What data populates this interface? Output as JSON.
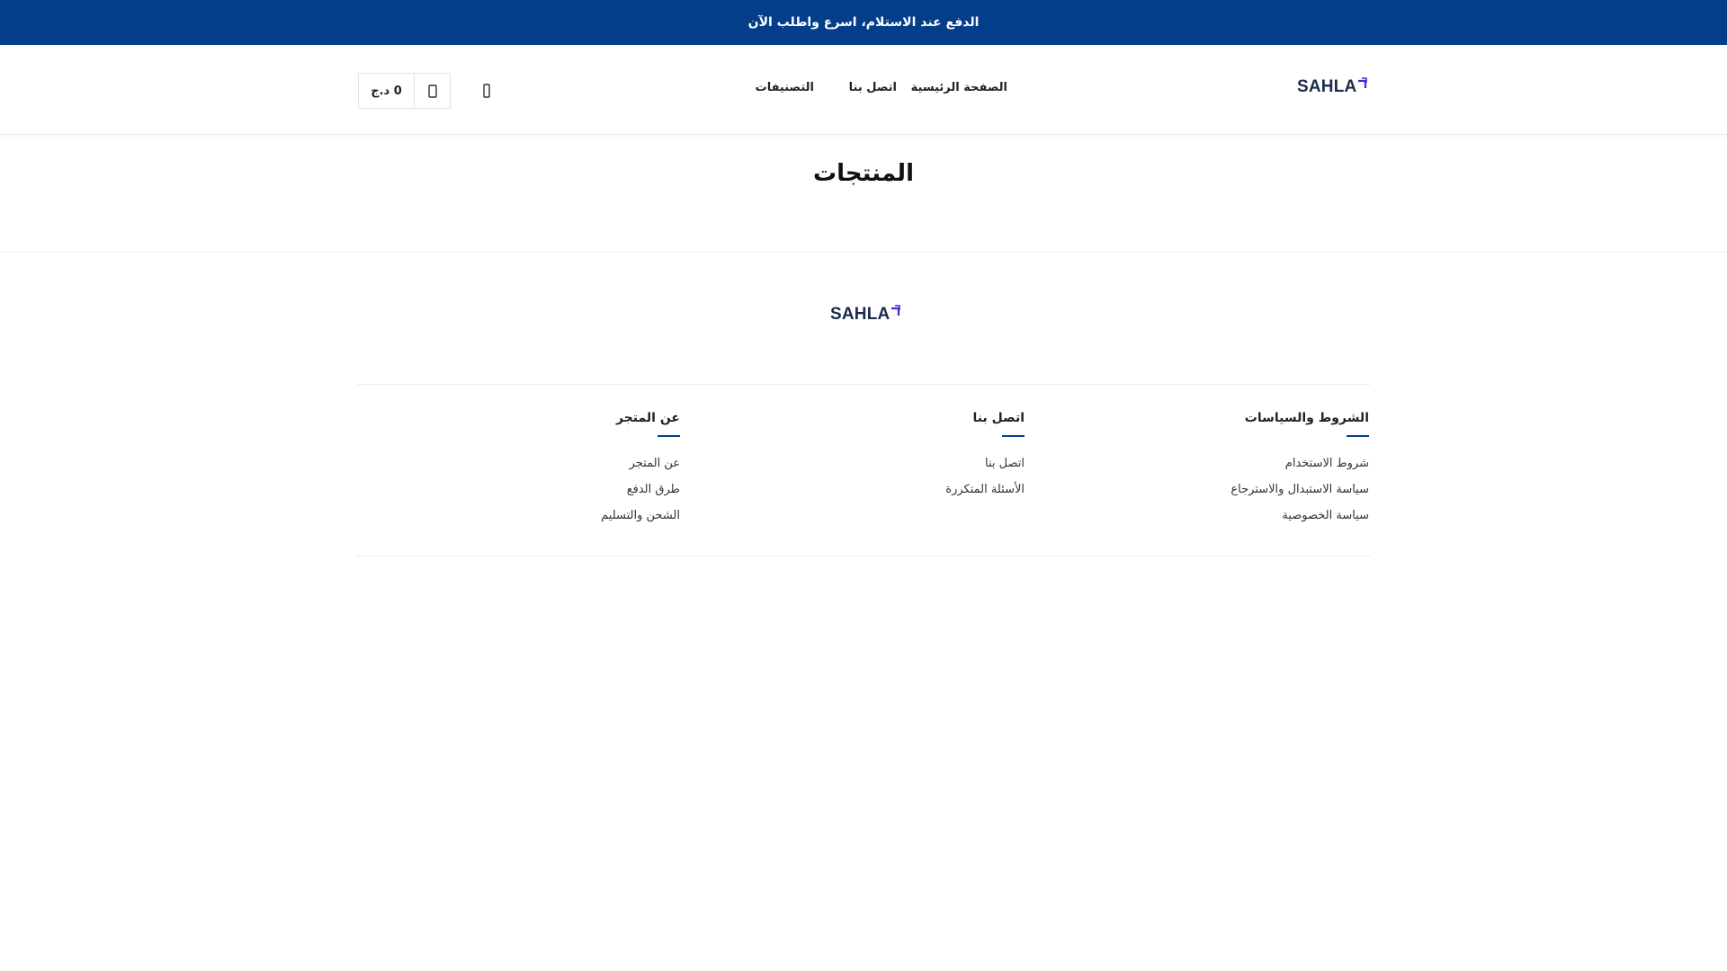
{
  "announcement": "الدفع عند الاستلام، اسرع واطلب الآن",
  "brand": {
    "logo_text": "SAHLA",
    "color": "#1b2b4d",
    "accent": "#3b2bd6"
  },
  "theme": {
    "primary": "#043e8a"
  },
  "nav": {
    "home": "الصفحة الرئيسية",
    "contact": "اتصل بنا",
    "categories": "التصنيفات"
  },
  "cart": {
    "total": "0 د.ج",
    "icon": "shopping-bag-icon"
  },
  "search": {
    "icon": "search-icon"
  },
  "page": {
    "title": "المنتجات"
  },
  "footer": {
    "columns": [
      {
        "title": "الشروط والسياسات",
        "links": [
          "شروط الاستخدام",
          "سياسة الاستبدال والاسترجاع",
          "سياسة الخصوصية"
        ]
      },
      {
        "title": "اتصل بنا",
        "links": [
          "اتصل بنا",
          "الأسئلة المتكررة"
        ]
      },
      {
        "title": "عن المتجر",
        "links": [
          "عن المتجر",
          "طرق الدفع",
          "الشحن والتسليم"
        ]
      }
    ]
  }
}
